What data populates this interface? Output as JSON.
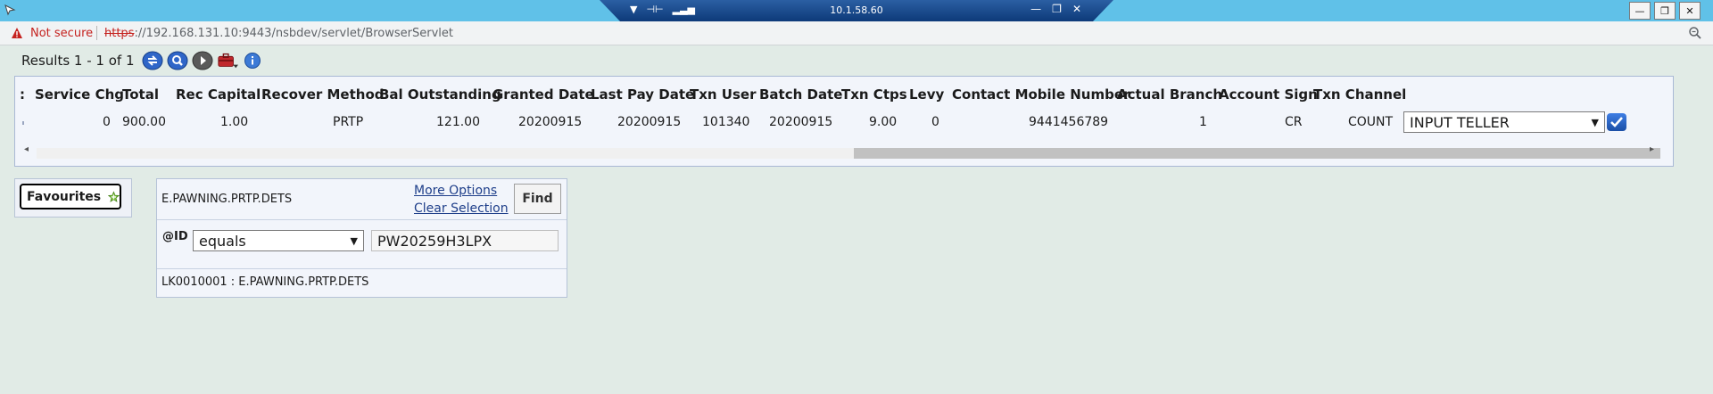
{
  "remote_desktop": {
    "host_ip": "10.1.58.60",
    "accent_color": "#0d3a79",
    "strip_color": "#60c1e8",
    "controls_left": [
      "chevron-down",
      "pin",
      "signal"
    ],
    "controls_right": [
      "minimize",
      "restore",
      "close"
    ]
  },
  "window_controls": [
    "minimize",
    "restore",
    "close"
  ],
  "browser": {
    "security_label": "Not secure",
    "url_scheme": "https",
    "url_rest": "://192.168.131.10:9443/nsbdev/servlet/BrowserServlet",
    "warning_color": "#c5221f"
  },
  "results": {
    "label": "Results 1 - 1 of 1",
    "toolbar_icons": [
      "refresh-icon",
      "search-icon",
      "next-icon",
      "toolbox-icon",
      "info-icon"
    ]
  },
  "table": {
    "columns": [
      "Service Chg",
      "Total",
      "Rec Capital",
      "Recover Method",
      "Bal Outstanding",
      "Granted Date",
      "Last Pay Date",
      "Txn User",
      "Batch Date",
      "Txn Ctps",
      "Levy",
      "Contact Mobile Number",
      "Actual Branch",
      "Account Sign",
      "Txn Channel"
    ],
    "rows": [
      [
        "0",
        "900.00",
        "1.00",
        "PRTP",
        "121.00",
        "20200915",
        "20200915",
        "101340",
        "20200915",
        "9.00",
        "0",
        "9441456789",
        "1",
        "CR",
        "COUNT"
      ]
    ],
    "row_action": {
      "selected": "INPUT TELLER"
    }
  },
  "favourites": {
    "label": "Favourites"
  },
  "search": {
    "enquiry": "E.PAWNING.PRTP.DETS",
    "more_options": "More Options",
    "clear_selection": "Clear Selection",
    "find": "Find",
    "field": "@ID",
    "operator": "equals",
    "value": "PW20259H3LPX",
    "footer": "LK0010001 : E.PAWNING.PRTP.DETS"
  }
}
